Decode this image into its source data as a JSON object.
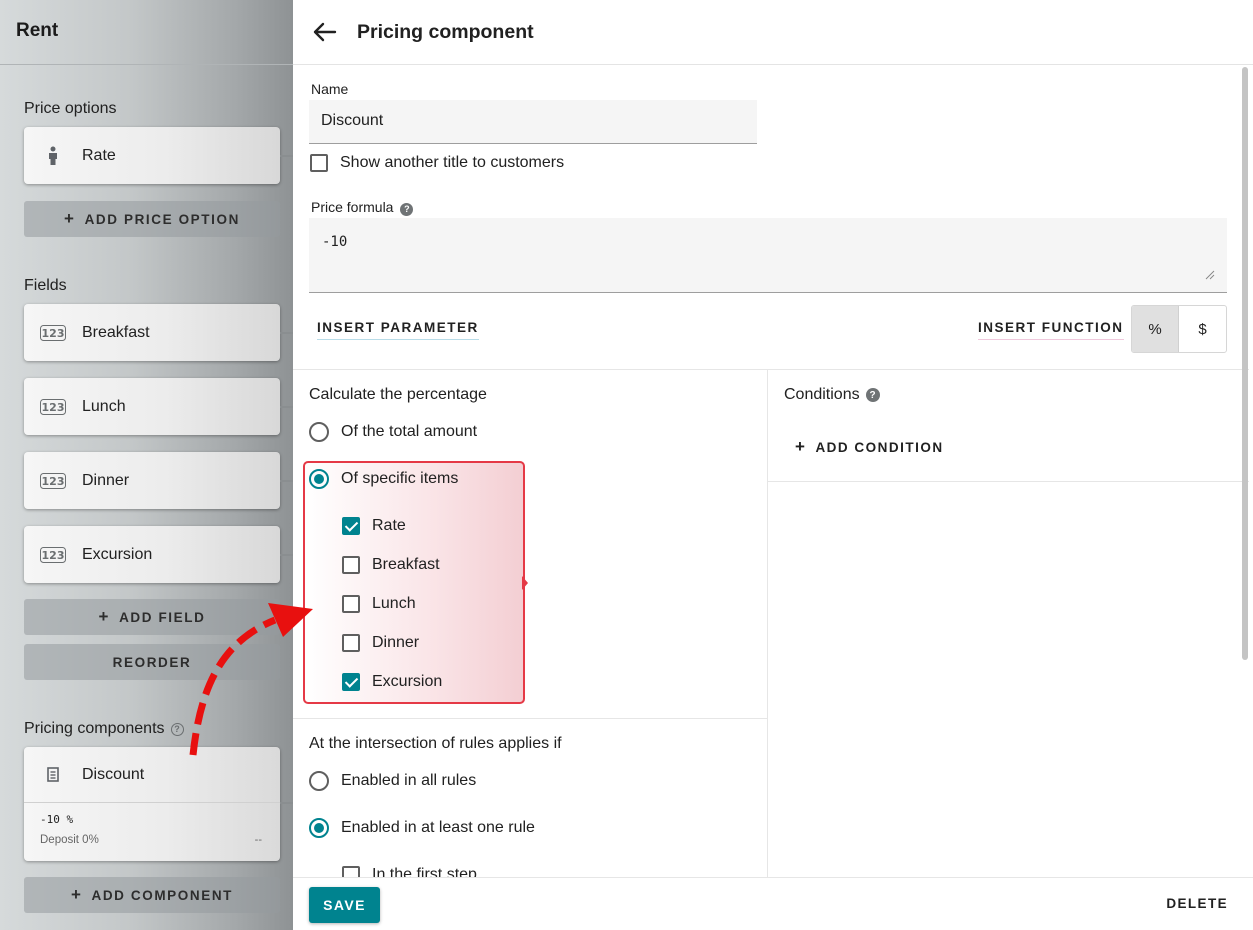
{
  "app": {
    "title": "Rent"
  },
  "sidebar": {
    "price_options_label": "Price options",
    "price_options": [
      {
        "label": "Rate",
        "icon": "person-icon"
      }
    ],
    "add_price_option": "ADD PRICE OPTION",
    "fields_label": "Fields",
    "fields": [
      {
        "label": "Breakfast",
        "icon": "number-123-icon"
      },
      {
        "label": "Lunch",
        "icon": "number-123-icon"
      },
      {
        "label": "Dinner",
        "icon": "number-123-icon"
      },
      {
        "label": "Excursion",
        "icon": "number-123-icon"
      }
    ],
    "add_field": "ADD FIELD",
    "reorder": "REORDER",
    "pricing_components_label": "Pricing components",
    "component": {
      "label": "Discount",
      "formula": "-10 %",
      "deposit": "Deposit 0%",
      "extra": "--"
    },
    "add_component": "ADD COMPONENT"
  },
  "editor": {
    "title": "Pricing component",
    "name_label": "Name",
    "name_value": "Discount",
    "show_title_label": "Show another title to customers",
    "show_title_checked": false,
    "formula_label": "Price formula",
    "formula_value": "-10",
    "insert_parameter": "INSERT PARAMETER",
    "insert_function": "INSERT FUNCTION",
    "unit_toggle": {
      "options": [
        "%",
        "$"
      ],
      "selected": "%"
    },
    "percentage": {
      "label": "Calculate the percentage",
      "options": [
        {
          "label": "Of the total amount",
          "selected": false
        },
        {
          "label": "Of specific items",
          "selected": true
        }
      ],
      "items": [
        {
          "label": "Rate",
          "checked": true
        },
        {
          "label": "Breakfast",
          "checked": false
        },
        {
          "label": "Lunch",
          "checked": false
        },
        {
          "label": "Dinner",
          "checked": false
        },
        {
          "label": "Excursion",
          "checked": true
        }
      ]
    },
    "conditions": {
      "label": "Conditions",
      "add_condition": "ADD CONDITION"
    },
    "intersection": {
      "label": "At the intersection of rules applies if",
      "options": [
        {
          "label": "Enabled in all rules",
          "selected": false
        },
        {
          "label": "Enabled in at least one rule",
          "selected": true
        }
      ],
      "sub_option": {
        "label": "In the first step",
        "checked": false
      }
    },
    "save": "SAVE",
    "delete": "DELETE"
  },
  "colors": {
    "accent": "#00838f",
    "highlight": "#e53946",
    "arrow": "#e8100f"
  }
}
